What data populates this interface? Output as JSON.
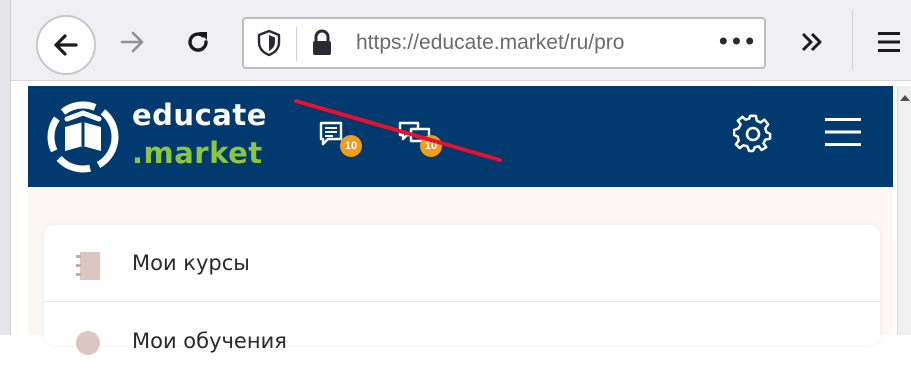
{
  "browser": {
    "url": "https://educate.market/ru/pro",
    "url_menu": "•••"
  },
  "site": {
    "logo_line1": "educate",
    "logo_line2": ".market",
    "notifications": [
      {
        "badge": "10"
      },
      {
        "badge": "10"
      }
    ]
  },
  "menu": {
    "items": [
      {
        "label": "Мои курсы"
      },
      {
        "label": "Мои обучения"
      }
    ]
  },
  "colors": {
    "header_bg": "#003a6e",
    "logo_accent": "#8cc63f",
    "badge": "#f29b1d",
    "annotation": "#e8112d"
  }
}
